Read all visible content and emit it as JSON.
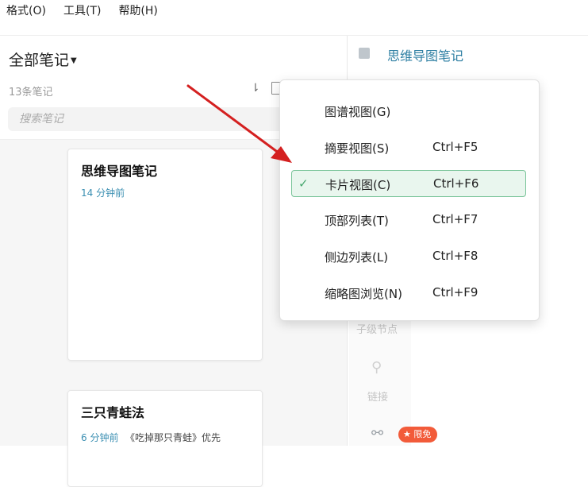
{
  "menubar": [
    "格式(O)",
    "工具(T)",
    "帮助(H)"
  ],
  "notes_panel": {
    "title": "全部笔记",
    "count": "13条笔记",
    "search_placeholder": "搜索笔记"
  },
  "cards": [
    {
      "title": "思维导图笔记",
      "time": "14 分钟前"
    },
    {
      "title": "三只青蛙法",
      "time": "6 分钟前",
      "excerpt": "《吃掉那只青蛙》优先"
    }
  ],
  "right_panel": {
    "title": "思维导图笔记",
    "sub_node_label": "子级节点",
    "link_label": "链接",
    "free_badge": "限免"
  },
  "dropdown": {
    "items": [
      {
        "label": "图谱视图(G)",
        "shortcut": "",
        "selected": false
      },
      {
        "label": "摘要视图(S)",
        "shortcut": "Ctrl+F5",
        "selected": false
      },
      {
        "label": "卡片视图(C)",
        "shortcut": "Ctrl+F6",
        "selected": true
      },
      {
        "label": "顶部列表(T)",
        "shortcut": "Ctrl+F7",
        "selected": false
      },
      {
        "label": "侧边列表(L)",
        "shortcut": "Ctrl+F8",
        "selected": false
      },
      {
        "label": "缩略图浏览(N)",
        "shortcut": "Ctrl+F9",
        "selected": false
      }
    ]
  },
  "colors": {
    "accent_green": "#48a76f",
    "selected_bg": "#e9f6ee",
    "title_blue": "#2e7fa3",
    "arrow_red": "#d42020",
    "badge_red": "#f25b3a"
  },
  "icons": [
    "sort-icon",
    "view-icon",
    "check-icon",
    "link-icon",
    "share-icon",
    "star-icon"
  ]
}
